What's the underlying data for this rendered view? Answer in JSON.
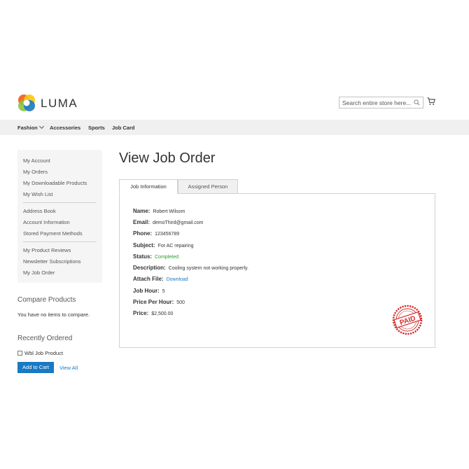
{
  "header": {
    "logo_text": "LUMA",
    "search_placeholder": "Search entire store here...",
    "icons": {
      "search": "search-icon",
      "cart": "cart-icon"
    }
  },
  "nav": {
    "items": [
      {
        "label": "Fashion",
        "has_dropdown": true
      },
      {
        "label": "Accessories"
      },
      {
        "label": "Sports"
      },
      {
        "label": "Job Card"
      }
    ]
  },
  "sidebar": {
    "groups": [
      [
        "My Account",
        "My Orders",
        "My Downloadable Products",
        "My Wish List"
      ],
      [
        "Address Book",
        "Account Information",
        "Stored Payment Methods"
      ],
      [
        "My Product Reviews",
        "Newsletter Subscriptions",
        "My Job Order"
      ]
    ]
  },
  "compare": {
    "title": "Compare Products",
    "empty_text": "You have no items to compare."
  },
  "recently_ordered": {
    "title": "Recently Ordered",
    "product": "Wbl Job Product",
    "add_to_cart": "Add to Cart",
    "view_all": "View All"
  },
  "main": {
    "title": "View Job Order",
    "tabs": [
      {
        "label": "Job Information",
        "active": true
      },
      {
        "label": "Assigned Person",
        "active": false
      }
    ],
    "fields": [
      {
        "label": "Name:",
        "value": "Robert Wilsom"
      },
      {
        "label": "Email:",
        "value": "demoThird@gmail.com"
      },
      {
        "label": "Phone:",
        "value": "123456789"
      },
      {
        "label": "Subject:",
        "value": "For AC repairing"
      },
      {
        "label": "Status:",
        "value": "Completed"
      },
      {
        "label": "Description:",
        "value": "Cooling system not working properly."
      },
      {
        "label": "Attach File:",
        "value": "Download"
      },
      {
        "label": "Job Hour:",
        "value": "5"
      },
      {
        "label": "Price Per Hour:",
        "value": "500"
      },
      {
        "label": "Price:",
        "value": "$2,500.00"
      }
    ],
    "stamp_text": "PAID"
  },
  "colors": {
    "accent": "#1979c3",
    "status_completed": "#2d9b2d",
    "stamp": "#d42b2b",
    "nav_bg": "#f0f0f0",
    "sidebar_bg": "#f5f5f5"
  }
}
